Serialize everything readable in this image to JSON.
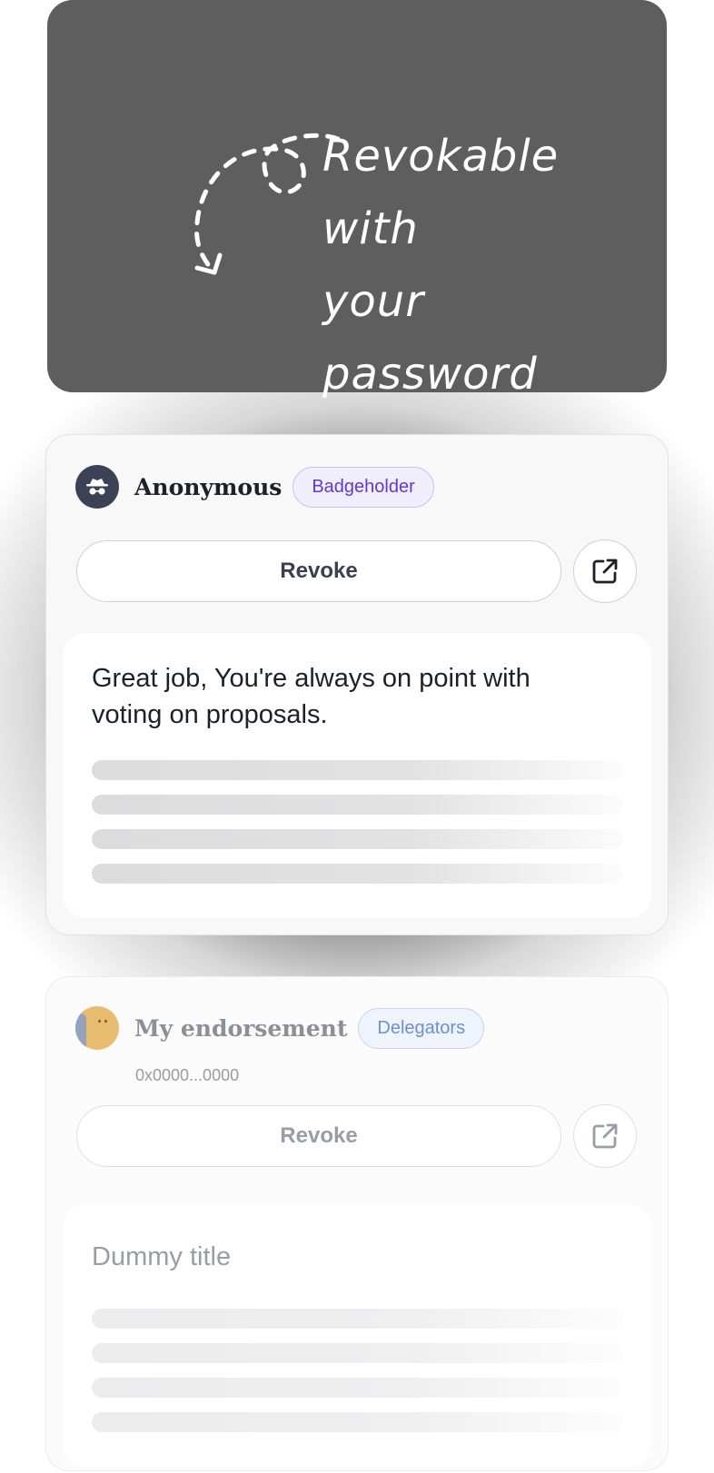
{
  "hero": {
    "line1": "Revokable with",
    "line2": "your password"
  },
  "active_card": {
    "name": "Anonymous",
    "badge": "Badgeholder",
    "avatar_icon": "incognito-icon",
    "revoke_label": "Revoke",
    "open_icon": "external-link-icon",
    "message": "Great job, You're always on point with voting on proposals."
  },
  "faded_card": {
    "name": "My endorsement",
    "badge": "Delegators",
    "address": "0x0000...0000",
    "revoke_label": "Revoke",
    "open_icon": "external-link-icon",
    "title": "Dummy title"
  },
  "colors": {
    "accent_badge": "#5b39d6",
    "delegator_badge": "#6d91cf",
    "dark_panel": "#5e5e5e"
  }
}
